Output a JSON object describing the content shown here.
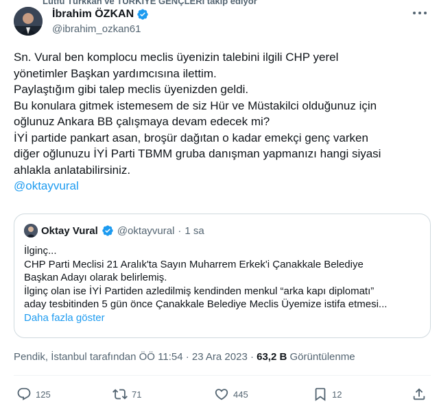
{
  "context_text": "Lütfü Türkkan ve TÜRKİYE GENÇLERİ takip ediyor",
  "author": {
    "name": "İbrahim ÖZKAN",
    "handle": "@ibrahim_ozkan61"
  },
  "tweet": {
    "lines": [
      "Sn. Vural ben komplocu meclis üyenizin talebini ilgili CHP yerel",
      "yönetimler Başkan yardımcısına ilettim.",
      "Paylaştığım gibi talep meclis üyenizden geldi.",
      "Bu konulara gitmek istemesem de siz Hür ve Müstakilci olduğunuz için",
      "oğlunuz Ankara BB çalışmaya devam edecek mi?",
      "İYİ partide pankart asan, broşür dağıtan o kadar emekçi genç varken",
      "diğer oğlunuzu İYİ Parti TBMM gruba danışman yapmanızı hangi siyasi",
      "ahlakla anlatabilirsiniz."
    ],
    "mention": "@oktayvural"
  },
  "quote": {
    "name": "Oktay Vural",
    "handle": "@oktayvural",
    "separator": "·",
    "time": "1 sa",
    "lines": [
      "İlginç...",
      "CHP Parti Meclisi 21 Aralık'ta Sayın Muharrem Erkek'i Çanakkale Belediye",
      "Başkan Adayı olarak belirlemiş.",
      "İlginç olan ise İYİ Partiden azledilmiş kendinden menkul “arka kapı diplomatı”",
      "aday tesbitinden 5 gün önce Çanakkale Belediye Meclis Üyemize istifa etmesi..."
    ],
    "show_more": "Daha fazla göster"
  },
  "meta": {
    "source": "Pendik, İstanbul tarafından ÖÖ 11:54 · 23 Ara 2023 ·",
    "views_count": "63,2 B",
    "views_label": "Görüntülenme"
  },
  "actions": {
    "replies": "125",
    "reposts": "71",
    "likes": "445",
    "bookmarks": "12"
  },
  "colors": {
    "accent": "#1d9bf0",
    "text": "#0f1419",
    "muted": "#536471",
    "border": "#cfd9de"
  }
}
